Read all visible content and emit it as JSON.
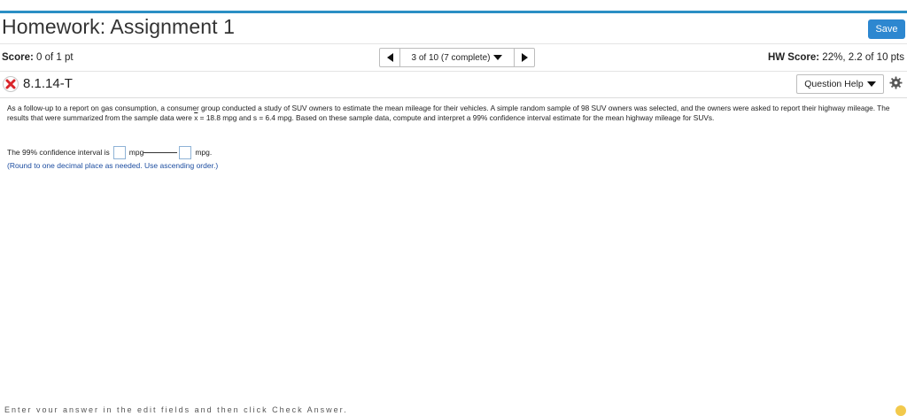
{
  "header": {
    "title": "Homework: Assignment 1",
    "save_label": "Save"
  },
  "score_bar": {
    "score_label": "Score:",
    "score_value": "0 of 1 pt",
    "nav_status": "3 of 10 (7 complete)",
    "hw_score_label": "HW Score:",
    "hw_score_value": "22%, 2.2 of 10 pts"
  },
  "problem": {
    "id": "8.1.14-T",
    "help_label": "Question Help",
    "text_part1": "As a follow-up to a report on gas consumption, a consumer group conducted a study of SUV owners to estimate the mean mileage for their vehicles. A simple random sample of 98 SUV owners was selected, and the owners were asked to report their highway mileage. The results that were summarized from the sample data were ",
    "xbar_symbol": "x",
    "text_part2": " = 18.8 mpg and s = 6.4 mpg. Based on these sample data, compute and interpret a 99% confidence interval estimate for the mean highway mileage for SUVs."
  },
  "answer": {
    "prefix": "The 99% confidence interval is",
    "mid_unit": "mpg",
    "end_unit": "mpg.",
    "hint": "(Round to one decimal place as needed. Use ascending order.)"
  },
  "footer": {
    "clipped_text": "Enter your answer in the edit fields and then click Check Answer."
  },
  "colors": {
    "accent": "#2b8fc4",
    "save_button": "#2d87d0",
    "incorrect": "#d9252a",
    "hint_text": "#1c4da0"
  }
}
